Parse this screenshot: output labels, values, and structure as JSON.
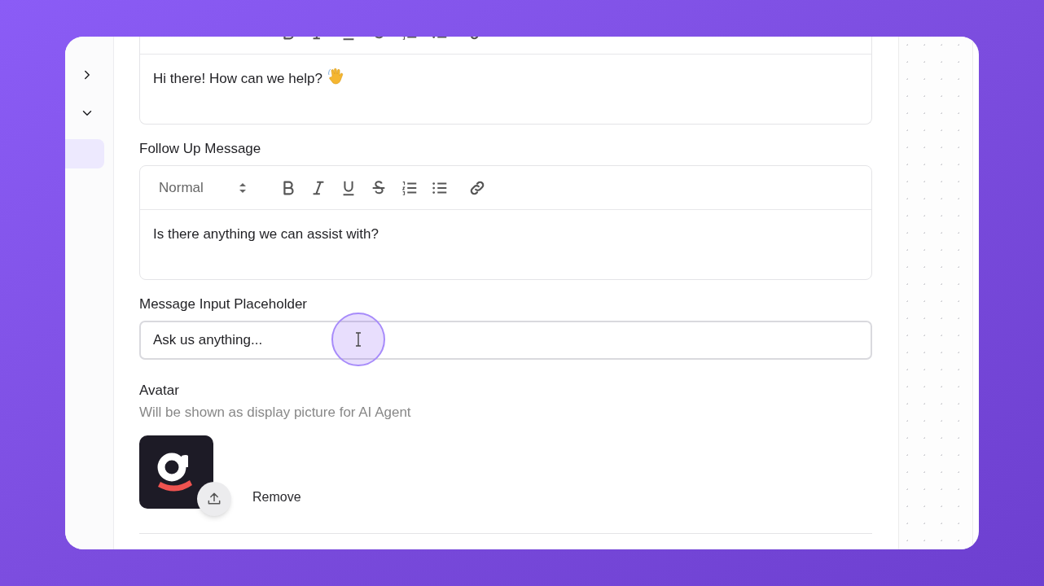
{
  "sidebar": {
    "items": [
      {
        "kind": "toggle",
        "expanded": false
      },
      {
        "kind": "toggle",
        "expanded": true
      },
      {
        "kind": "entry",
        "selected": true
      }
    ]
  },
  "editors": [
    {
      "text": "Hi there! How can we help?",
      "waving_hand": true
    },
    {
      "label": "Follow Up Message",
      "format": "Normal",
      "text": "Is there anything we can assist with?"
    }
  ],
  "placeholder_field": {
    "label": "Message Input Placeholder",
    "value": "Ask us anything..."
  },
  "avatar": {
    "label": "Avatar",
    "description": "Will be shown as display picture for AI Agent",
    "remove": "Remove"
  }
}
